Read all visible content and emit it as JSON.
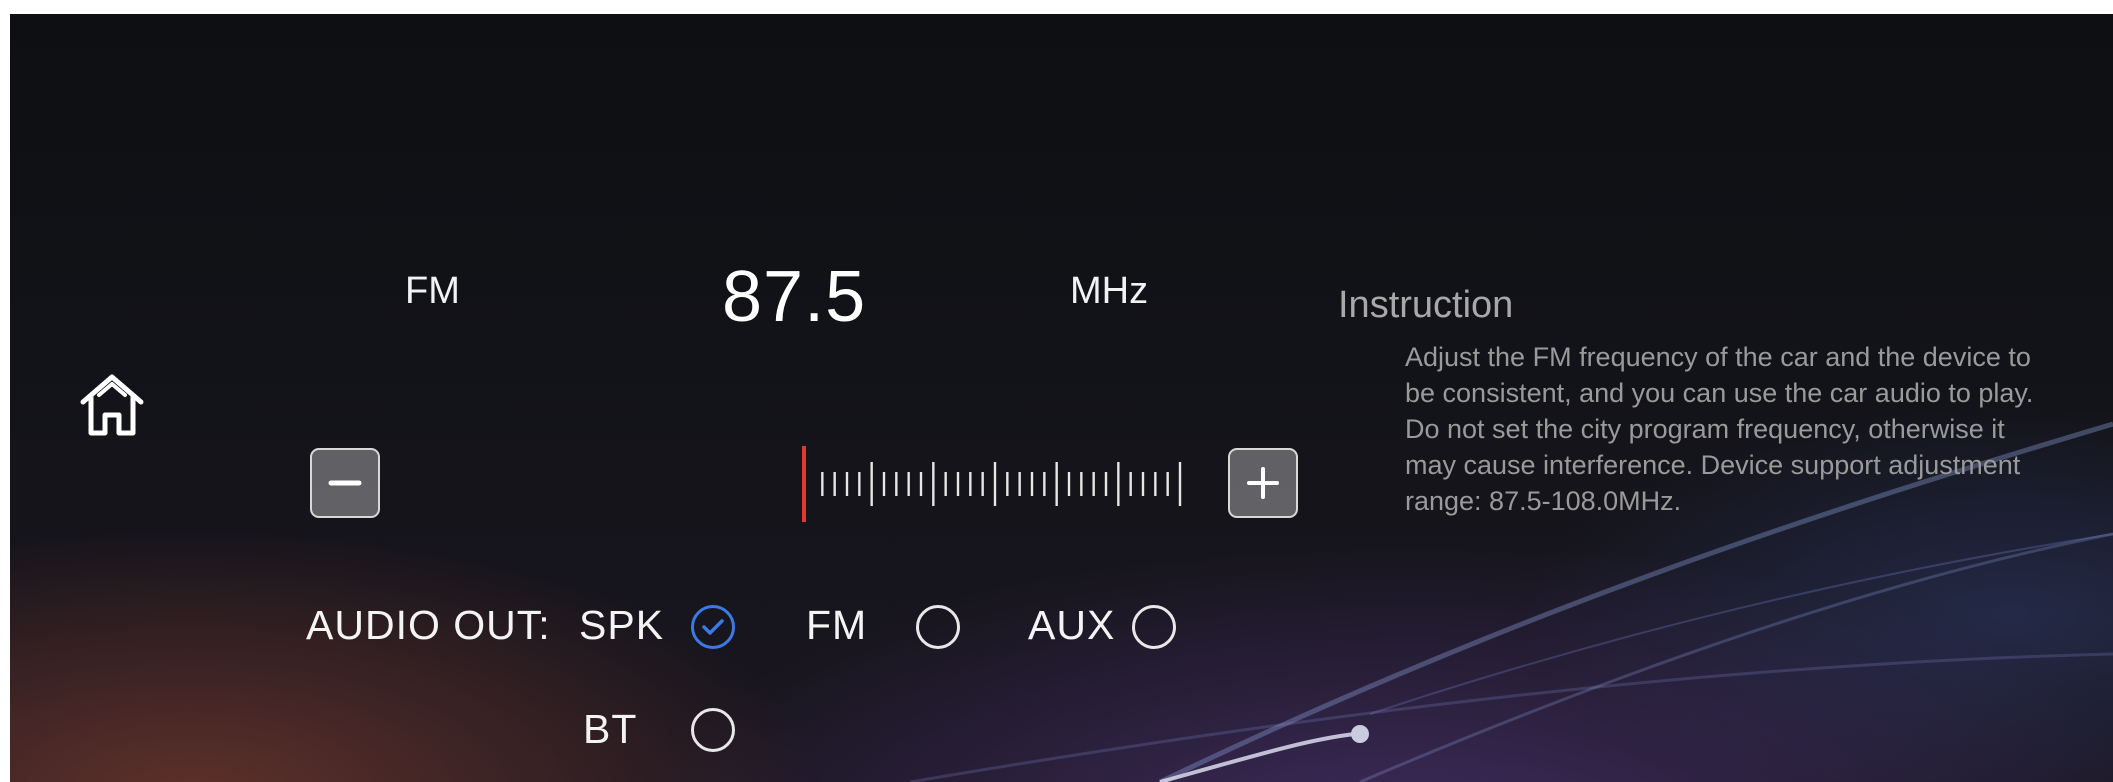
{
  "tuner": {
    "band": "FM",
    "frequency": "87.5",
    "unit": "MHz",
    "range_min": 87.5,
    "range_max": 108.0,
    "current": 87.5,
    "indicator_color": "#e03a2f"
  },
  "instruction": {
    "title": "Instruction",
    "body": "Adjust the FM frequency of the car and the device to be consistent, and you can use the car audio to play. Do not set the city program frequency, otherwise it may cause interference. Device support adjustment range: 87.5-108.0MHz."
  },
  "audio_out": {
    "label": "AUDIO OUT:",
    "options": [
      {
        "label": "SPK",
        "selected": true
      },
      {
        "label": "FM",
        "selected": false
      },
      {
        "label": "AUX",
        "selected": false
      },
      {
        "label": "BT",
        "selected": false
      }
    ]
  },
  "icons": {
    "home": "home-icon",
    "minus": "minus-icon",
    "plus": "plus-icon",
    "check": "check-icon"
  },
  "colors": {
    "accent": "#3a7ae6",
    "indicator": "#e03a2f"
  }
}
